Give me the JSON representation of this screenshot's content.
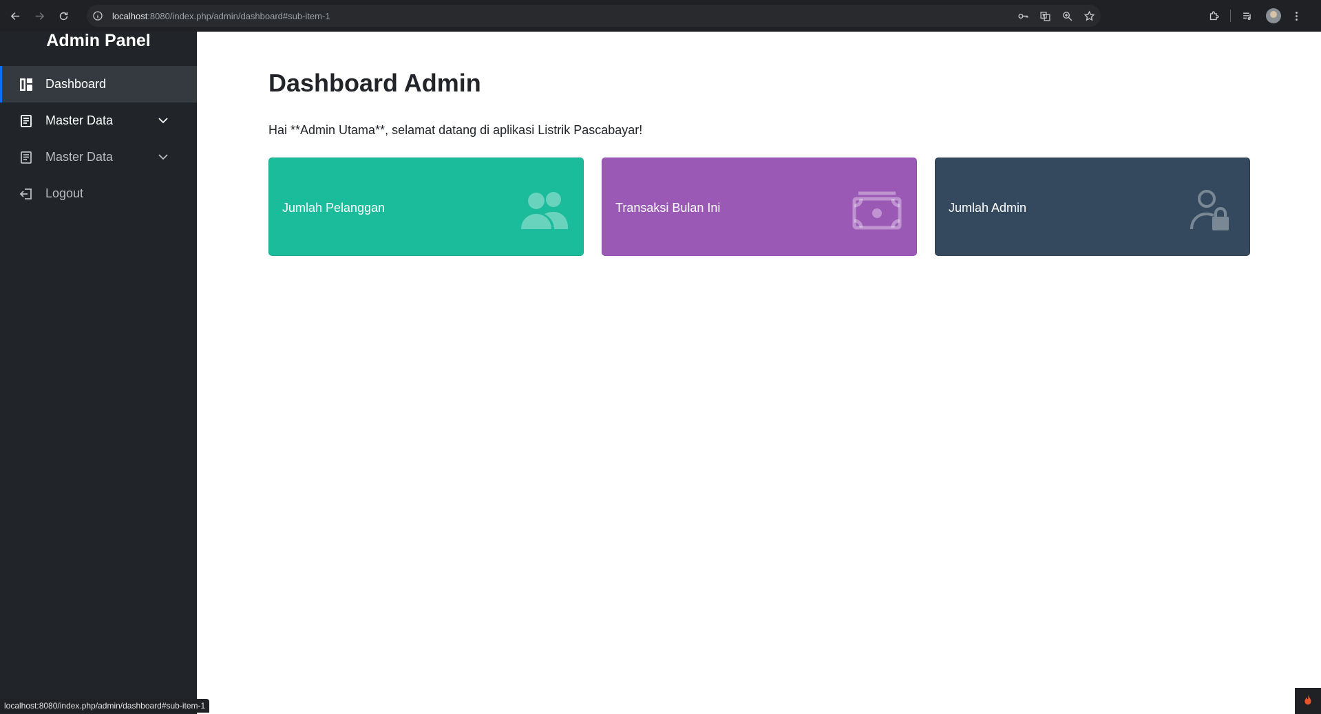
{
  "browser": {
    "url_host": "localhost",
    "url_rest": ":8080/index.php/admin/dashboard#sub-item-1",
    "status_url": "localhost:8080/index.php/admin/dashboard#sub-item-1"
  },
  "sidebar": {
    "brand": "Admin Panel",
    "items": [
      {
        "label": "Dashboard",
        "icon": "dashboard-icon",
        "active": true
      },
      {
        "label": "Master Data",
        "icon": "document-icon",
        "has_submenu": true
      },
      {
        "label": "Master Data",
        "icon": "document-icon",
        "has_submenu": true
      },
      {
        "label": "Logout",
        "icon": "logout-icon"
      }
    ]
  },
  "main": {
    "title": "Dashboard Admin",
    "welcome": "Hai **Admin Utama**, selamat datang di aplikasi Listrik Pascabayar!",
    "cards": [
      {
        "label": "Jumlah Pelanggan",
        "icon": "users-icon",
        "color": "#1abc9c"
      },
      {
        "label": "Transaksi Bulan Ini",
        "icon": "money-icon",
        "color": "#9b59b6"
      },
      {
        "label": "Jumlah Admin",
        "icon": "admin-lock-icon",
        "color": "#34495e"
      }
    ]
  },
  "colors": {
    "sidebar_bg": "#212529",
    "sidebar_active_bg": "#343a40",
    "accent": "#0d6efd",
    "chrome_bg": "#202124"
  }
}
